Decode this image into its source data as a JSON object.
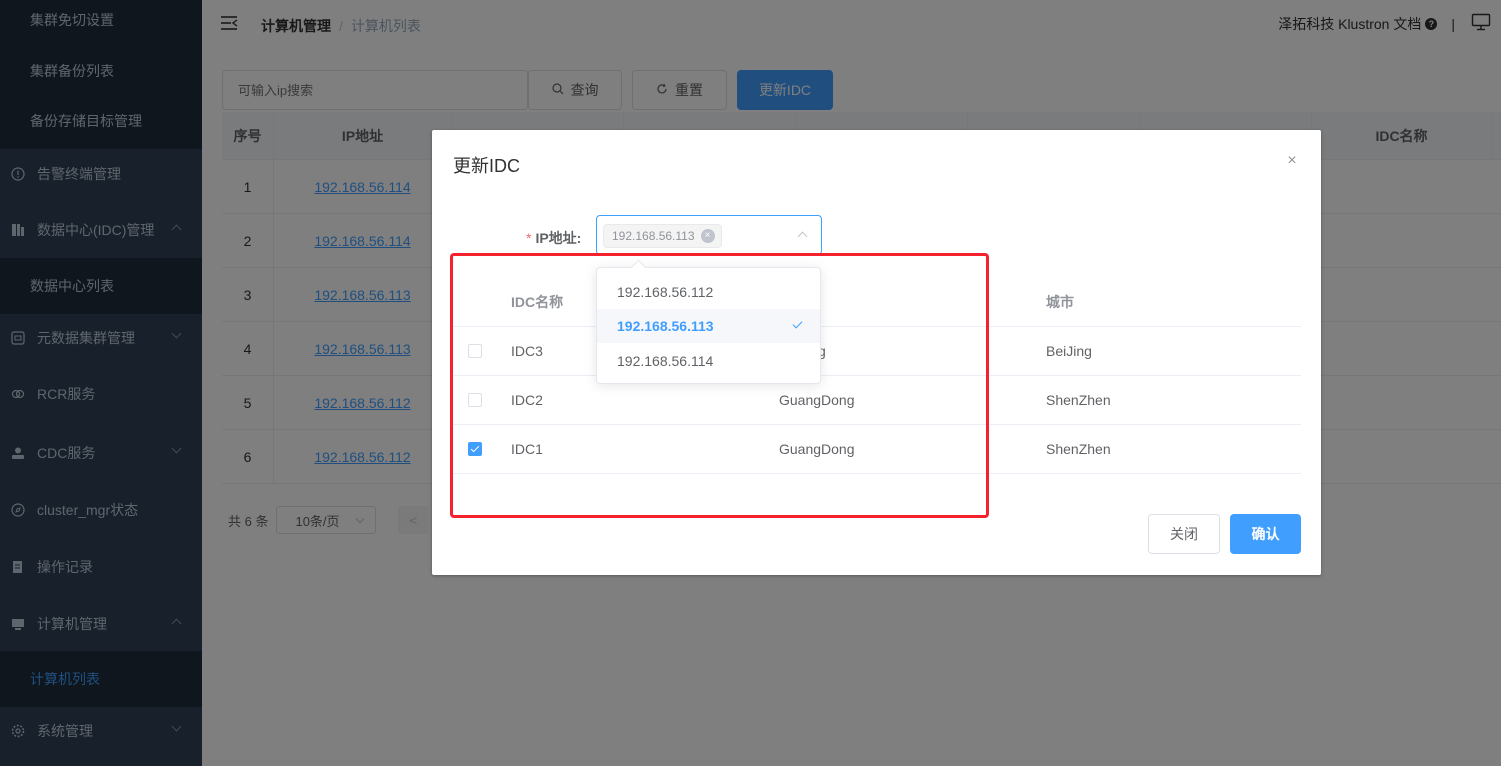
{
  "sidebar": {
    "items": [
      {
        "label": "集群免切设置",
        "type": "sub"
      },
      {
        "label": "集群备份列表",
        "type": "sub"
      },
      {
        "label": "备份存储目标管理",
        "type": "sub"
      },
      {
        "label": "告警终端管理",
        "type": "top",
        "icon": "alert-circle-icon"
      },
      {
        "label": "数据中心(IDC)管理",
        "type": "top",
        "icon": "datacenter-icon",
        "expanded": true
      },
      {
        "label": "数据中心列表",
        "type": "sub"
      },
      {
        "label": "元数据集群管理",
        "type": "top",
        "icon": "metadata-icon"
      },
      {
        "label": "RCR服务",
        "type": "top",
        "icon": "rcr-icon"
      },
      {
        "label": "CDC服务",
        "type": "top",
        "icon": "user-icon"
      },
      {
        "label": "cluster_mgr状态",
        "type": "top",
        "icon": "compass-icon"
      },
      {
        "label": "操作记录",
        "type": "top",
        "icon": "record-icon"
      },
      {
        "label": "计算机管理",
        "type": "top",
        "icon": "monitor-icon",
        "expanded": true
      },
      {
        "label": "计算机列表",
        "type": "sub",
        "active": true
      },
      {
        "label": "系统管理",
        "type": "top",
        "icon": "gear-icon"
      }
    ]
  },
  "header": {
    "breadcrumb": [
      "计算机管理",
      "计算机列表"
    ],
    "brand": "泽拓科技 Klustron 文档",
    "help": "?",
    "separator": "|"
  },
  "toolbar": {
    "search_placeholder": "可输入ip搜索",
    "query_label": "查询",
    "reset_label": "重置",
    "update_idc_label": "更新IDC"
  },
  "table": {
    "headers": [
      "序号",
      "IP地址",
      "IDC名称"
    ],
    "rows": [
      {
        "index": "1",
        "ip": "192.168.56.114"
      },
      {
        "index": "2",
        "ip": "192.168.56.114"
      },
      {
        "index": "3",
        "ip": "192.168.56.113"
      },
      {
        "index": "4",
        "ip": "192.168.56.113"
      },
      {
        "index": "5",
        "ip": "192.168.56.112"
      },
      {
        "index": "6",
        "ip": "192.168.56.112"
      }
    ]
  },
  "pager": {
    "total": "共 6 条",
    "page_size": "10条/页",
    "prev": "<"
  },
  "dialog": {
    "title": "更新IDC",
    "close": "×",
    "ip_label": "IP地址:",
    "required_mark": "*",
    "selected_tag": "192.168.56.113",
    "tag_close": "×",
    "inner_headers": [
      "IDC名称",
      "城市"
    ],
    "inner_rows": [
      {
        "name": "IDC3",
        "province": "g",
        "city": "BeiJing",
        "checked": false
      },
      {
        "name": "IDC2",
        "province": "GuangDong",
        "city": "ShenZhen",
        "checked": false
      },
      {
        "name": "IDC1",
        "province": "GuangDong",
        "city": "ShenZhen",
        "checked": true
      }
    ],
    "close_button": "关闭",
    "confirm_button": "确认"
  },
  "dropdown": {
    "options": [
      {
        "label": "192.168.56.112",
        "selected": false
      },
      {
        "label": "192.168.56.113",
        "selected": true
      },
      {
        "label": "192.168.56.114",
        "selected": false
      }
    ]
  },
  "colors": {
    "primary": "#409eff",
    "sidebar_bg": "#304156",
    "highlight_box": "#f5222d"
  }
}
